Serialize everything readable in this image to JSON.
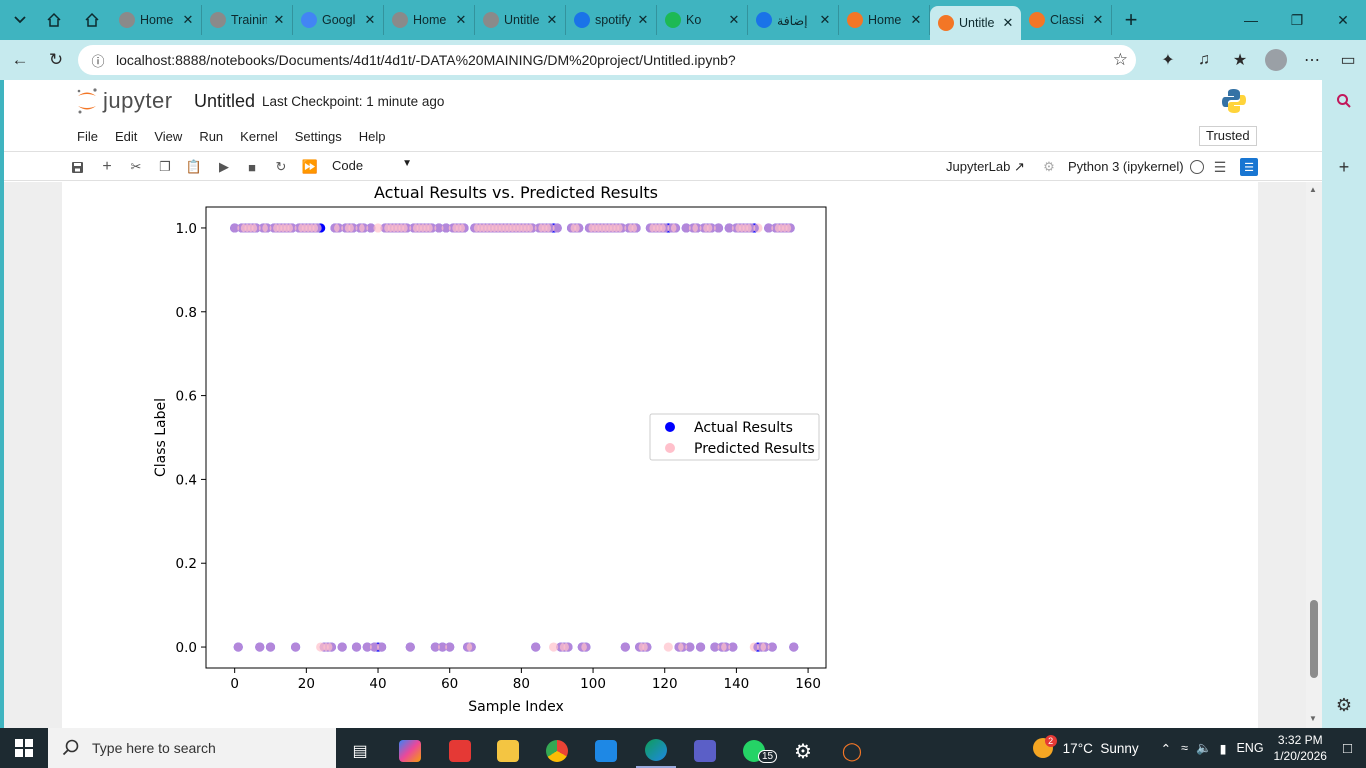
{
  "browser": {
    "tabs": [
      {
        "title": "Home",
        "color": "#8a8a8a"
      },
      {
        "title": "Trainin",
        "color": "#8a8a8a"
      },
      {
        "title": "Googl",
        "color": "#4285f4"
      },
      {
        "title": "Home",
        "color": "#8a8a8a"
      },
      {
        "title": "Untitle",
        "color": "#8a8a8a"
      },
      {
        "title": "spotify",
        "color": "#1a73e8"
      },
      {
        "title": "Ko",
        "color": "#1db954"
      },
      {
        "title": "إضافة",
        "color": "#1a73e8"
      },
      {
        "title": "Home",
        "color": "#f37626"
      },
      {
        "title": "Untitle",
        "color": "#f37626",
        "active": true
      },
      {
        "title": "Classi",
        "color": "#f37626"
      }
    ],
    "url": "localhost:8888/notebooks/Documents/4d1t/4d1t/-DATA%20MAINING/DM%20project/Untitled.ipynb?"
  },
  "jupyter": {
    "logo_text": "jupyter",
    "notebook_title": "Untitled",
    "checkpoint": "Last Checkpoint: 1 minute ago",
    "menu": [
      "File",
      "Edit",
      "View",
      "Run",
      "Kernel",
      "Settings",
      "Help"
    ],
    "trusted": "Trusted",
    "cell_type": "Code",
    "jupyterlab_link": "JupyterLab",
    "kernel": "Python 3 (ipykernel)"
  },
  "chart_data": {
    "type": "scatter",
    "title": "Actual Results vs. Predicted Results",
    "xlabel": "Sample Index",
    "ylabel": "Class Label",
    "xlim": [
      -8,
      165
    ],
    "ylim": [
      -0.05,
      1.05
    ],
    "xticks": [
      0,
      20,
      40,
      60,
      80,
      100,
      120,
      140,
      160
    ],
    "xtick_labels": [
      "0",
      "20",
      "40",
      "60",
      "80",
      "100",
      "120",
      "140",
      "160"
    ],
    "yticks": [
      0.0,
      0.2,
      0.4,
      0.6,
      0.8,
      1.0
    ],
    "ytick_labels": [
      "0.0",
      "0.2",
      "0.4",
      "0.6",
      "0.8",
      "1.0"
    ],
    "legend_position": "center-right",
    "grid": false,
    "series": [
      {
        "name": "Actual Results",
        "color": "#0000ff",
        "ones": [
          0,
          2,
          3,
          4,
          5,
          6,
          8,
          9,
          11,
          12,
          13,
          14,
          15,
          16,
          18,
          19,
          20,
          21,
          22,
          23,
          24,
          28,
          29,
          31,
          32,
          33,
          35,
          36,
          38,
          42,
          43,
          44,
          45,
          46,
          47,
          48,
          50,
          51,
          52,
          53,
          54,
          55,
          57,
          59,
          61,
          62,
          63,
          64,
          67,
          68,
          69,
          70,
          71,
          72,
          73,
          74,
          75,
          76,
          77,
          78,
          79,
          80,
          81,
          82,
          83,
          85,
          86,
          87,
          88,
          89,
          90,
          94,
          95,
          96,
          99,
          100,
          101,
          102,
          103,
          104,
          105,
          106,
          107,
          108,
          110,
          111,
          112,
          116,
          117,
          118,
          119,
          120,
          121,
          122,
          123,
          126,
          128,
          129,
          131,
          132,
          133,
          135,
          138,
          140,
          141,
          142,
          143,
          144,
          145,
          149,
          151,
          152,
          153,
          154,
          155
        ],
        "zeros": [
          1,
          7,
          10,
          17,
          25,
          26,
          27,
          30,
          34,
          37,
          39,
          40,
          41,
          49,
          56,
          58,
          60,
          65,
          66,
          84,
          91,
          92,
          93,
          97,
          98,
          109,
          113,
          114,
          115,
          124,
          125,
          127,
          130,
          134,
          136,
          137,
          139,
          146,
          147,
          148,
          150,
          156
        ]
      },
      {
        "name": "Predicted Results",
        "color": "#ffc0cb",
        "ones": [
          0,
          2,
          3,
          4,
          5,
          6,
          8,
          9,
          11,
          12,
          13,
          14,
          15,
          16,
          18,
          19,
          20,
          21,
          22,
          23,
          28,
          29,
          31,
          32,
          33,
          35,
          36,
          38,
          40,
          42,
          43,
          44,
          45,
          46,
          47,
          48,
          50,
          51,
          52,
          53,
          54,
          55,
          57,
          59,
          61,
          62,
          63,
          64,
          67,
          68,
          69,
          70,
          71,
          72,
          73,
          74,
          75,
          76,
          77,
          78,
          79,
          80,
          81,
          82,
          83,
          85,
          86,
          87,
          88,
          90,
          94,
          95,
          96,
          99,
          100,
          101,
          102,
          103,
          104,
          105,
          106,
          107,
          108,
          110,
          111,
          112,
          116,
          117,
          118,
          119,
          120,
          122,
          123,
          126,
          128,
          129,
          131,
          132,
          133,
          135,
          138,
          140,
          141,
          142,
          143,
          144,
          146,
          149,
          151,
          152,
          153,
          154,
          155
        ],
        "zeros": [
          1,
          7,
          10,
          17,
          24,
          25,
          26,
          27,
          30,
          34,
          37,
          39,
          41,
          49,
          56,
          58,
          60,
          65,
          66,
          84,
          89,
          91,
          92,
          93,
          97,
          98,
          109,
          113,
          114,
          115,
          121,
          124,
          125,
          127,
          130,
          134,
          136,
          137,
          139,
          145,
          147,
          148,
          150,
          156
        ]
      }
    ]
  },
  "taskbar": {
    "search_placeholder": "Type here to search",
    "weather": "17°C  Sunny",
    "lang": "ENG",
    "time": "3:32 PM",
    "date": "1/20/2026",
    "whatsapp_badge": "15",
    "weather_badge": "2"
  }
}
